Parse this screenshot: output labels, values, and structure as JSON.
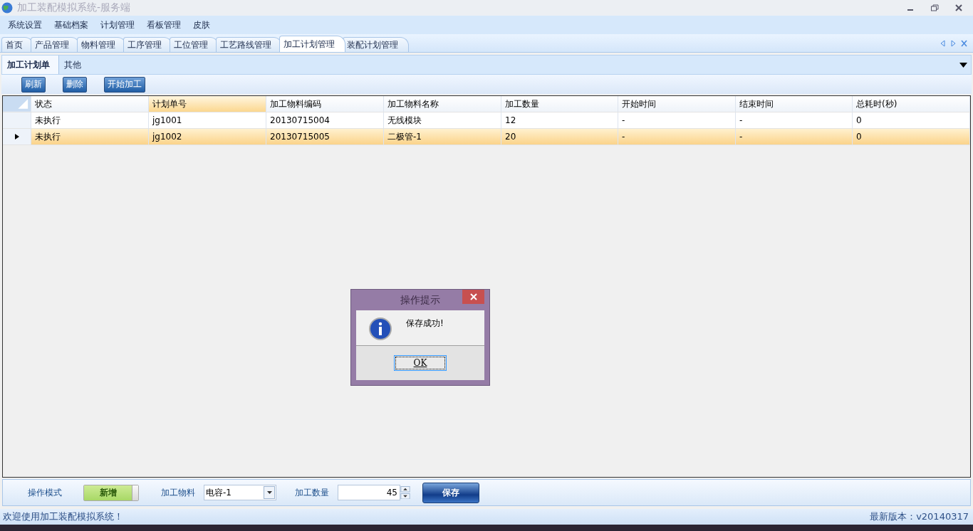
{
  "window": {
    "title": "加工装配模拟系统-服务端"
  },
  "menu": [
    "系统设置",
    "基础档案",
    "计划管理",
    "看板管理",
    "皮肤"
  ],
  "tabs": [
    {
      "label": "首页",
      "selected": false
    },
    {
      "label": "产品管理",
      "selected": false
    },
    {
      "label": "物料管理",
      "selected": false
    },
    {
      "label": "工序管理",
      "selected": false
    },
    {
      "label": "工位管理",
      "selected": false
    },
    {
      "label": "工艺路线管理",
      "selected": false
    },
    {
      "label": "加工计划管理",
      "selected": true
    },
    {
      "label": "装配计划管理",
      "selected": false
    }
  ],
  "sub_tabs": [
    {
      "label": "加工计划单",
      "selected": true
    },
    {
      "label": "其他",
      "selected": false
    }
  ],
  "toolbar": [
    "刷新",
    "删除",
    "开始加工"
  ],
  "table": {
    "columns": [
      {
        "label": "状态",
        "sorted": false
      },
      {
        "label": "计划单号",
        "sorted": true
      },
      {
        "label": "加工物料编码",
        "sorted": false
      },
      {
        "label": "加工物料名称",
        "sorted": false
      },
      {
        "label": "加工数量",
        "sorted": false
      },
      {
        "label": "开始时间",
        "sorted": false
      },
      {
        "label": "结束时间",
        "sorted": false
      },
      {
        "label": "总耗时(秒)",
        "sorted": false
      }
    ],
    "rows": [
      {
        "selected": false,
        "cells": [
          "未执行",
          "jg1001",
          "20130715004",
          "无线模块",
          "12",
          "-",
          "-",
          "0"
        ]
      },
      {
        "selected": true,
        "cells": [
          "未执行",
          "jg1002",
          "20130715005",
          "二极管-1",
          "20",
          "-",
          "-",
          "0"
        ]
      }
    ]
  },
  "form": {
    "mode_label": "操作模式",
    "mode_toggle": {
      "label": "新增",
      "on": true
    },
    "material_label": "加工物料",
    "material_value": "电容-1",
    "quantity_label": "加工数量",
    "quantity_value": "45",
    "save_button": "保存"
  },
  "dialog": {
    "title": "操作提示",
    "message": "保存成功!",
    "ok_button": "OK"
  },
  "status_bar": {
    "left": "欢迎使用加工装配模拟系统！",
    "right": "最新版本：v20140317"
  }
}
